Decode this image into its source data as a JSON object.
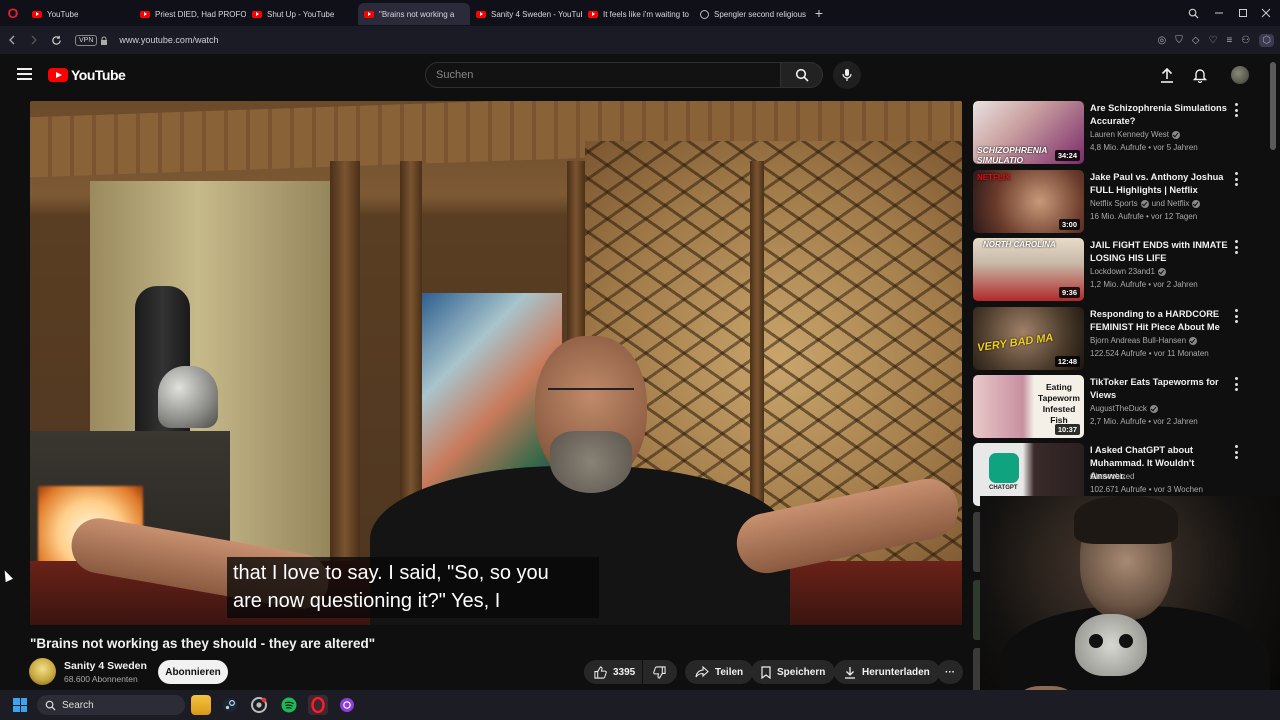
{
  "browser": {
    "tabs": [
      {
        "label": "YouTube",
        "icon": "youtube-icon",
        "active": false
      },
      {
        "label": "Priest DIED, Had PROFOU",
        "icon": "youtube-icon",
        "active": false
      },
      {
        "label": "Shut Up - YouTube",
        "icon": "youtube-icon",
        "active": false
      },
      {
        "label": "\"Brains not working a",
        "icon": "youtube-icon",
        "active": true
      },
      {
        "label": "Sanity 4 Sweden - YouTub",
        "icon": "youtube-icon",
        "active": false
      },
      {
        "label": "It feels like i'm waiting to",
        "icon": "youtube-icon",
        "active": false
      },
      {
        "label": "Spengler second religious",
        "icon": "globe-icon",
        "active": false
      }
    ],
    "new_tab_symbol": "+",
    "vpn_label": "VPN",
    "url": "www.youtube.com/watch"
  },
  "youtube": {
    "logo_text": "YouTube",
    "search_placeholder": "Suchen",
    "video": {
      "caption": "that I love to say. I said, \"So, so you\nare now questioning it?\" Yes, I",
      "title": "\"Brains not working as they should - they are altered\"",
      "channel_name": "Sanity 4 Sweden",
      "subscribers": "68.600 Abonnenten",
      "subscribe_label": "Abonnieren",
      "likes": "3395",
      "share_label": "Teilen",
      "save_label": "Speichern",
      "download_label": "Herunterladen",
      "more_label": "···"
    },
    "recommendations": [
      {
        "title": "Are Schizophrenia Simulations Accurate?",
        "channel": "Lauren Kennedy West",
        "verified": true,
        "meta": "4,8 Mio. Aufrufe • vor 5 Jahren",
        "duration": "34:24",
        "thumb_text": "SCHIZOPHRENIA SIMULATIO",
        "thumb_color": "#8a3a8a"
      },
      {
        "title": "Jake Paul vs. Anthony Joshua FULL Highlights | Netflix",
        "channel": "Netflix Sports",
        "channel_extra": "und Netflix",
        "verified": true,
        "meta": "16 Mio. Aufrufe • vor 12 Tagen",
        "duration": "3:00",
        "thumb_text": "NETFLIX",
        "thumb_color": "#5a2a2a"
      },
      {
        "title": "JAIL FIGHT ENDS with INMATE LOSING HIS LIFE",
        "channel": "Lockdown 23and1",
        "verified": true,
        "meta": "1,2 Mio. Aufrufe • vor 2 Jahren",
        "duration": "9:36",
        "thumb_text": "NORTH CAROLINA",
        "thumb_color": "#8a2a2a"
      },
      {
        "title": "Responding to a HARDCORE FEMINIST Hit Piece About Me",
        "channel": "Bjorn Andreas Bull-Hansen",
        "verified": true,
        "meta": "122.524 Aufrufe • vor 11 Monaten",
        "duration": "12:48",
        "thumb_text": "VERY BAD MA",
        "thumb_color": "#3a3028"
      },
      {
        "title": "TikToker Eats Tapeworms for Views",
        "channel": "AugustTheDuck",
        "verified": true,
        "meta": "2,7 Mio. Aufrufe • vor 2 Jahren",
        "duration": "10:37",
        "thumb_text": "Eating Tapeworm Infested Fish",
        "thumb_color": "#d8c8a8"
      },
      {
        "title": "I Asked ChatGPT about Muhammad. It Wouldn't Answer.",
        "channel": "Chatechized",
        "verified": false,
        "meta": "102.671 Aufrufe • vor 3 Wochen",
        "duration": "",
        "thumb_text": "CHATGPT",
        "thumb_color": "#2a3a3a"
      }
    ]
  },
  "taskbar": {
    "search_label": "Search",
    "apps": [
      "file-explorer-icon",
      "steam-icon",
      "chrome-icon",
      "spotify-icon",
      "opera-icon",
      "purple-app-icon"
    ]
  },
  "colors": {
    "youtube_red": "#ff0000",
    "background": "#0f0f0f",
    "text_primary": "#f1f1f1",
    "text_secondary": "#aaaaaa"
  }
}
